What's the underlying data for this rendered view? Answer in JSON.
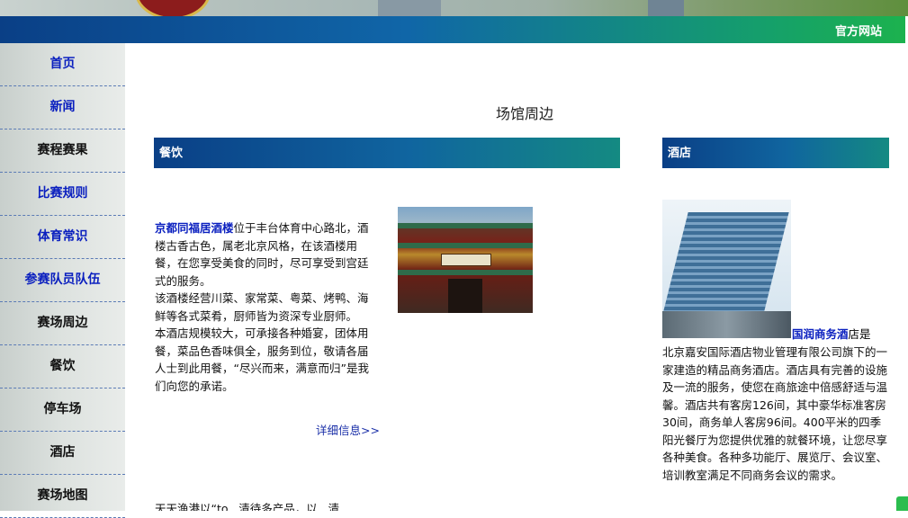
{
  "header": {
    "official_site_label": "官方网站"
  },
  "sidebar": {
    "items": [
      {
        "label": "首页"
      },
      {
        "label": "新闻"
      },
      {
        "label": "赛程赛果"
      },
      {
        "label": "比赛规则"
      },
      {
        "label": "体育常识"
      },
      {
        "label": "参赛队员队伍"
      },
      {
        "label": "赛场周边"
      },
      {
        "label": "餐饮"
      },
      {
        "label": "停车场"
      },
      {
        "label": "酒店"
      },
      {
        "label": "赛场地图"
      }
    ]
  },
  "main": {
    "page_title": "场馆周边",
    "dining": {
      "heading": "餐饮",
      "restaurant_name": "京都同福居酒楼",
      "paragraph_1": "位于丰台体育中心路北，酒楼古香古色，属老北京风格，在该酒楼用餐，在您享受美食的同时，尽可享受到宫廷式的服务。",
      "paragraph_2": "该酒楼经营川菜、家常菜、粤菜、烤鸭、海鲜等各式菜肴，厨师皆为资深专业厨师。",
      "paragraph_3": "本酒店规模较大，可承接各种婚宴，团体用餐，菜品色香味俱全，服务到位，敬请各届人士到此用餐，“尽兴而来，满意而归”是我们向您的承诺。",
      "more_link": "详细信息>>",
      "next_entry_partial": "天天渔港以“to...清待多产品，以...清"
    },
    "hotel": {
      "heading": "酒店",
      "hotel_name": "国润商务酒",
      "name_suffix": "店是",
      "description": "北京嘉安国际酒店物业管理有限公司旗下的一家建造的精品商务酒店。酒店具有完善的设施及一流的服务，使您在商旅途中倍感舒适与温馨。酒店共有客房126间，其中豪华标准客房30间，商务单人客房96间。400平米的四季阳光餐厅为您提供优雅的就餐环境，让您尽享各种美食。各种多功能厅、展览厅、会议室、培训教室满足不同商务会议的需求。"
    }
  },
  "colors": {
    "banner_start": "#0a3f86",
    "banner_end": "#1cb24e",
    "link_blue": "#0a1fbf"
  }
}
